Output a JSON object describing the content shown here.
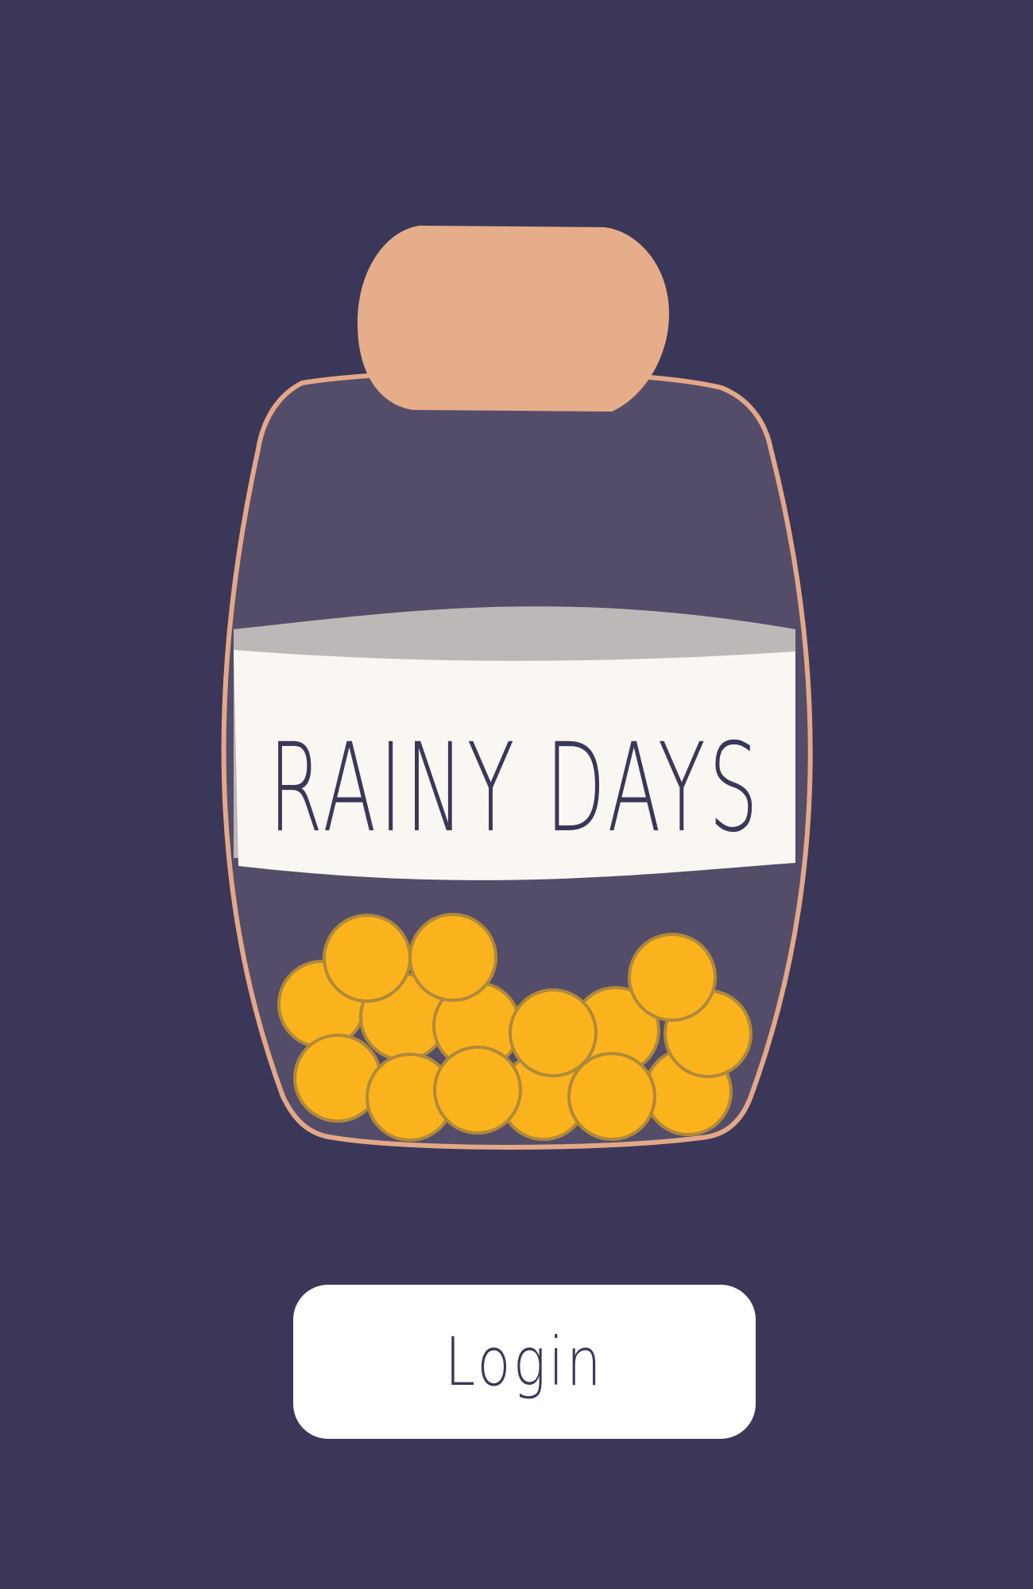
{
  "app": {
    "title": "RAINY DAYS",
    "colors": {
      "background": "#3b3759",
      "jar_body": "#534d6a",
      "jar_outline": "#e3a888",
      "lid": "#e5ad8a",
      "label_band": "#faf6f2",
      "label_shade": "#bdb7b7",
      "coin_fill": "#fbb31d",
      "coin_stroke": "#b0893a",
      "text": "#3b3759",
      "button_bg": "#ffffff"
    },
    "icons": {
      "jar": "coin-jar-icon",
      "coins": "coin-icon"
    }
  },
  "login_button": {
    "label": "Login"
  }
}
